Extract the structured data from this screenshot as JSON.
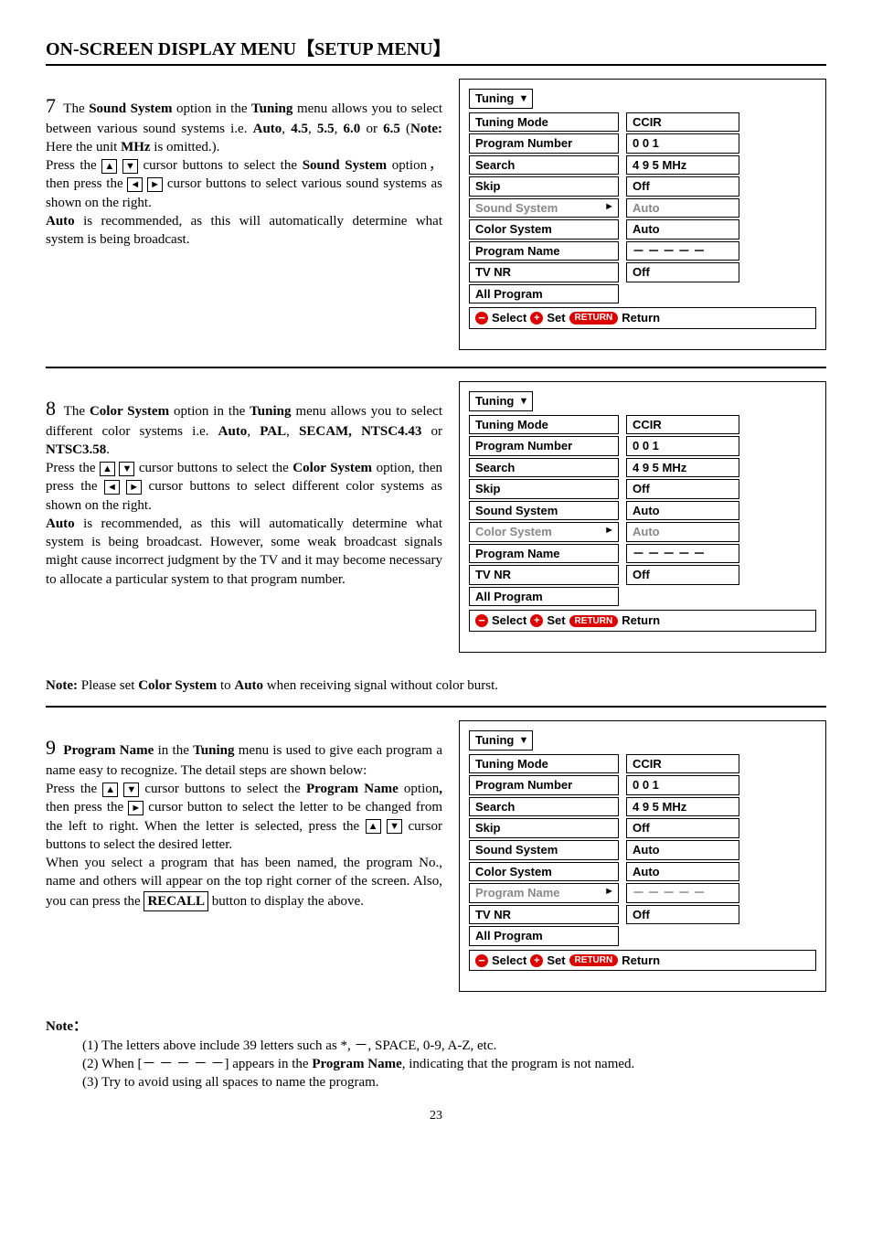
{
  "title_a": "ON-SCREEN DISPLAY MENU",
  "title_b": "SETUP MENU",
  "sec7": {
    "num": "7",
    "t1": "The ",
    "b1": "Sound System",
    "t2": " option in the ",
    "b2": "Tuning",
    "t3": " menu allows you to select between various sound systems i.e. ",
    "b3": "Auto",
    "t4": ", ",
    "b4": "4.5",
    "t5": ", ",
    "b5": "5.5",
    "t6": ", ",
    "b6": "6.0",
    "t7": " or ",
    "b7": "6.5",
    "t8": " (",
    "b8": "Note:",
    "t9": " Here the unit ",
    "b9": "MHz",
    "t10": " is omitted.).",
    "p2a": "Press the ",
    "p2b": " cursor buttons to select the ",
    "p2c": "Sound System",
    "p2d": " option， then press the ",
    "p2e": " cursor buttons to select various sound systems as shown on the right.",
    "p3a": "Auto",
    "p3b": " is recommended, as this will automatically determine what system is being broadcast."
  },
  "sec8": {
    "num": "8",
    "t1": "The ",
    "b1": "Color System",
    "t2": " option in the ",
    "b2": "Tuning",
    "t3": " menu allows you to select different color systems i.e. ",
    "b3": "Auto",
    "t4": ", ",
    "b4": "PAL",
    "t5": ", ",
    "b5": "SECAM, NTSC4.43",
    "t6": " or ",
    "b6": "NTSC3.58",
    "t7": ".",
    "p2a": "Press the ",
    "p2b": " cursor buttons to select the ",
    "p2c": "Color System",
    "p2d": " option, then press the ",
    "p2e": " cursor buttons to select different color systems as shown on the right.",
    "p3a": "Auto",
    "p3b": " is recommended, as this will automatically determine what system is being broadcast. However, some weak broadcast signals might cause incorrect judgment by the TV and it may become necessary to allocate a particular system to that program number."
  },
  "note_inter": {
    "a": "Note:",
    "b": " Please set ",
    "c": "Color System",
    "d": " to ",
    "e": "Auto",
    "f": " when receiving signal without color burst."
  },
  "sec9": {
    "num": "9",
    "b1": "Program Name",
    "t1": " in the ",
    "b2": "Tuning",
    "t2": " menu is used to give each program a name easy to recognize. The detail steps are shown below:",
    "p2a": "Press the ",
    "p2b": " cursor buttons to select the ",
    "p2c": "Program Name",
    "p2d": " option",
    "p2e": ",",
    "p2f": " then press the ",
    "p2g": " cursor button to select the letter to be changed from the left to right. When the letter is selected, press the ",
    "p2h": " cursor buttons to select the desired letter.",
    "p3": "When you select a program that has been named, the program No., name and others will appear on the top right corner of the screen. Also, you can press the ",
    "p3b": "RECALL",
    "p3c": " button to display the above."
  },
  "menu_title": "Tuning",
  "menu_labels": {
    "mode": "Tuning Mode",
    "pnum": "Program Number",
    "search": "Search",
    "skip": "Skip",
    "sound": "Sound System",
    "color": "Color System",
    "pname": "Program Name",
    "tvnr": "TV NR",
    "all": "All Program"
  },
  "menu_values": {
    "mode": "CCIR",
    "pnum": "0 0 1",
    "search": "4 9 5 MHz",
    "skip": "Off",
    "sound": "Auto",
    "color": "Auto",
    "pname": "－ － － － －",
    "tvnr": "Off"
  },
  "footer_select": "Select",
  "footer_set": "Set",
  "footer_return_pill": "RETURN",
  "footer_return": "Return",
  "notes": {
    "h": "Note：",
    "n1": "(1) The letters above include 39 letters such as *, －, SPACE, 0-9, A-Z, etc.",
    "n2a": "(2) When [－ － － － －] appears in the ",
    "n2b": "Program Name",
    "n2c": ", indicating that the program is not named.",
    "n3": "(3) Try to avoid using all spaces to name the program."
  },
  "pagenum": "23",
  "glyph_up": "▲",
  "glyph_down": "▼",
  "glyph_left": "◄",
  "glyph_right": "►"
}
